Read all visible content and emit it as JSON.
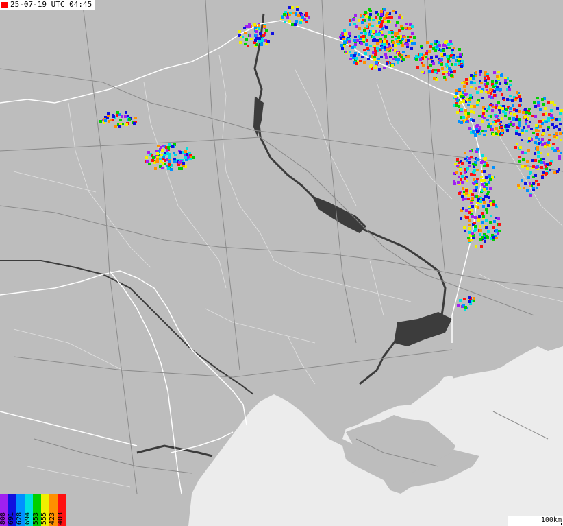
{
  "header": {
    "timestamp": "25-07-19 UTC 04:45"
  },
  "legend": {
    "items": [
      {
        "label": "808",
        "color": "#a020f0"
      },
      {
        "label": "691",
        "color": "#1010e0"
      },
      {
        "label": "628",
        "color": "#0090ff"
      },
      {
        "label": "694",
        "color": "#00e0e0"
      },
      {
        "label": "553",
        "color": "#00d000"
      },
      {
        "label": "555",
        "color": "#f0f000"
      },
      {
        "label": "423",
        "color": "#ff9000"
      },
      {
        "label": "403",
        "color": "#ff1010"
      }
    ]
  },
  "scale": {
    "label": "100km"
  },
  "colors": {
    "land": "#bdbdbd",
    "sea": "#ececec",
    "water": "#3c3c3c",
    "border": "#ffffff",
    "road": "#8a8a8a"
  }
}
